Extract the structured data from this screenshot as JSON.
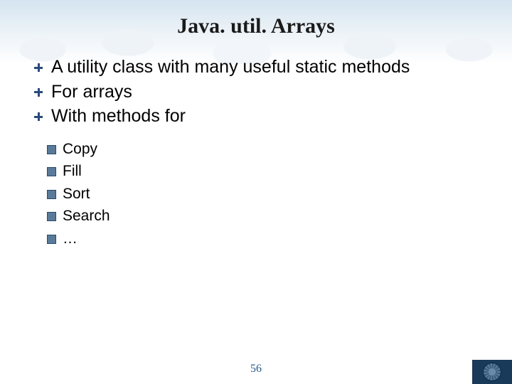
{
  "title": "Java. util. Arrays",
  "bullets": [
    "A utility class with many useful static methods",
    "For arrays",
    "With methods for"
  ],
  "sub_bullets": [
    "Copy",
    "Fill",
    "Sort",
    "Search",
    "…"
  ],
  "page_number": "56"
}
